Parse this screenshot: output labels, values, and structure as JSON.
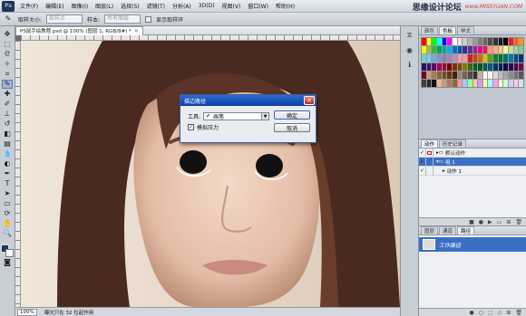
{
  "menubar": {
    "logo": "Ps",
    "items": [
      "文件(F)",
      "编辑(E)",
      "图像(I)",
      "图层(L)",
      "选择(S)",
      "滤镜(T)",
      "分析(A)",
      "3D(D)",
      "视图(V)",
      "窗口(W)",
      "帮助(H)"
    ],
    "watermark_cn": "思缘设计论坛",
    "watermark_url": "www.MISSYUAN.COM"
  },
  "options": {
    "brush_size_label": "取样大小:",
    "brush_size_value": "取样点",
    "sample_label": "样本:",
    "sample_value": "所有图层",
    "show_ring_label": "显示取样环"
  },
  "document": {
    "tab_title": "PS鼠手绘教程.psd @ 100% (图层 1, RGB/8#) *",
    "zoom": "100%",
    "status": "曝光只在 32 位起作用"
  },
  "dialog": {
    "title": "描边路径",
    "tool_label": "工具:",
    "tool_value": "画笔",
    "simulate_pressure": "模拟压力",
    "simulate_checked": "✓",
    "ok": "确定",
    "cancel": "取消"
  },
  "panels": {
    "swatch_tabs": [
      "颜色",
      "色板",
      "样式"
    ],
    "action_tabs": [
      "动作",
      "历史记录"
    ],
    "actions": [
      {
        "name": "默认动作",
        "kind": "set"
      },
      {
        "name": "组 1",
        "kind": "set",
        "selected": true
      },
      {
        "name": "动作 1",
        "kind": "action"
      }
    ],
    "layer_tabs": [
      "图层",
      "通道",
      "路径"
    ],
    "path_name": "工作路径"
  },
  "swatch_colors": [
    "#ff0000",
    "#ffff00",
    "#00ff00",
    "#00ffff",
    "#0000ff",
    "#ff00ff",
    "#ffffff",
    "#e6e6e6",
    "#cccccc",
    "#b3b3b3",
    "#999999",
    "#808080",
    "#666666",
    "#4d4d4d",
    "#333333",
    "#1a1a1a",
    "#000000",
    "#ed1c24",
    "#f26522",
    "#f7941d",
    "#fff200",
    "#8dc63f",
    "#39b54a",
    "#00a651",
    "#00a99d",
    "#00aeef",
    "#0072bc",
    "#0054a6",
    "#2e3192",
    "#662d91",
    "#92278f",
    "#ec008c",
    "#ed145b",
    "#f7977a",
    "#f9ad81",
    "#fdc689",
    "#fff799",
    "#c4df9b",
    "#a3d39c",
    "#82ca9c",
    "#7accc8",
    "#6dcff6",
    "#7da7d9",
    "#8393ca",
    "#8781bd",
    "#a186be",
    "#bd8cbf",
    "#f49ac1",
    "#f5989d",
    "#c1272d",
    "#c4470f",
    "#cb6d0d",
    "#d3c400",
    "#5e9a2b",
    "#197b30",
    "#007236",
    "#00746b",
    "#0076a3",
    "#004a80",
    "#003471",
    "#1b1464",
    "#440e62",
    "#630460",
    "#9e005d",
    "#9e0039",
    "#790000",
    "#7b2e00",
    "#7d4900",
    "#827b00",
    "#406618",
    "#005e20",
    "#005826",
    "#005952",
    "#005b7f",
    "#003663",
    "#002157",
    "#0d004c",
    "#32004b",
    "#4b0049",
    "#7b0046",
    "#7a0026",
    "#c69c6d",
    "#a67c52",
    "#8c6239",
    "#754c24",
    "#603913",
    "#42210b",
    "#998675",
    "#736357",
    "#534741",
    "#362f2d",
    "#c7b299",
    "#ffffff",
    "#f2f2f2",
    "#d9d9d9",
    "#bfbfbf",
    "#a6a6a6",
    "#8c8c8c",
    "#737373",
    "#595959",
    "#404040",
    "#262626",
    "#0d0d0d",
    "#e5b79b",
    "#c89a7d",
    "#aa7c5f",
    "#8f6147",
    "#ff9999",
    "#99ccff",
    "#99ff99",
    "#ffcc99",
    "#cc99ff",
    "#ffff99",
    "#99ffff",
    "#ff99ff",
    "#ffffcc",
    "#ccffcc",
    "#ccccff",
    "#ffcccc",
    "#cce5ff"
  ]
}
